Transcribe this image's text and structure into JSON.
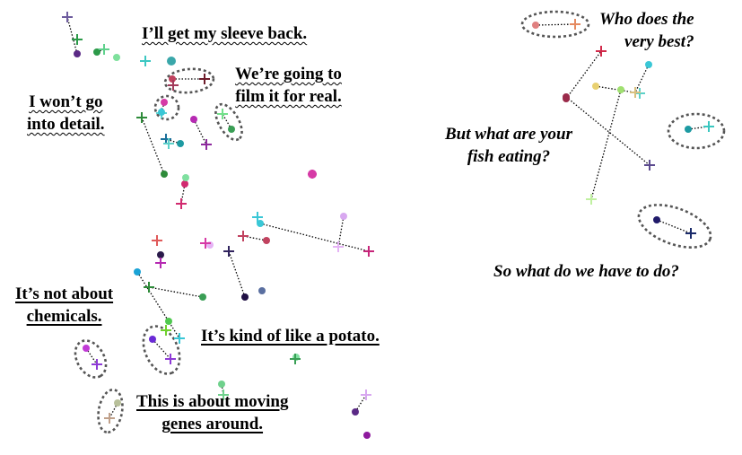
{
  "captions": {
    "sleeve": "I’ll get my sleeve back.",
    "film_1": "We’re going to",
    "film_2": "film it for real.",
    "detail_1": "I won’t go",
    "detail_2": "into detail.",
    "best_1": "Who does the",
    "best_2": "very best?",
    "fish_1": "But what are your",
    "fish_2": "fish eating?",
    "todo": "So what do we have to do?",
    "chem_1": "It’s not about",
    "chem_2": "chemicals.",
    "potato": "It’s kind of like a potato.",
    "genes_1": "This is about moving",
    "genes_2": "genes around."
  },
  "colors": {
    "text": "#000000",
    "ellipse_stroke": "#555555",
    "link_stroke": "#000000",
    "background": "#ffffff"
  }
}
